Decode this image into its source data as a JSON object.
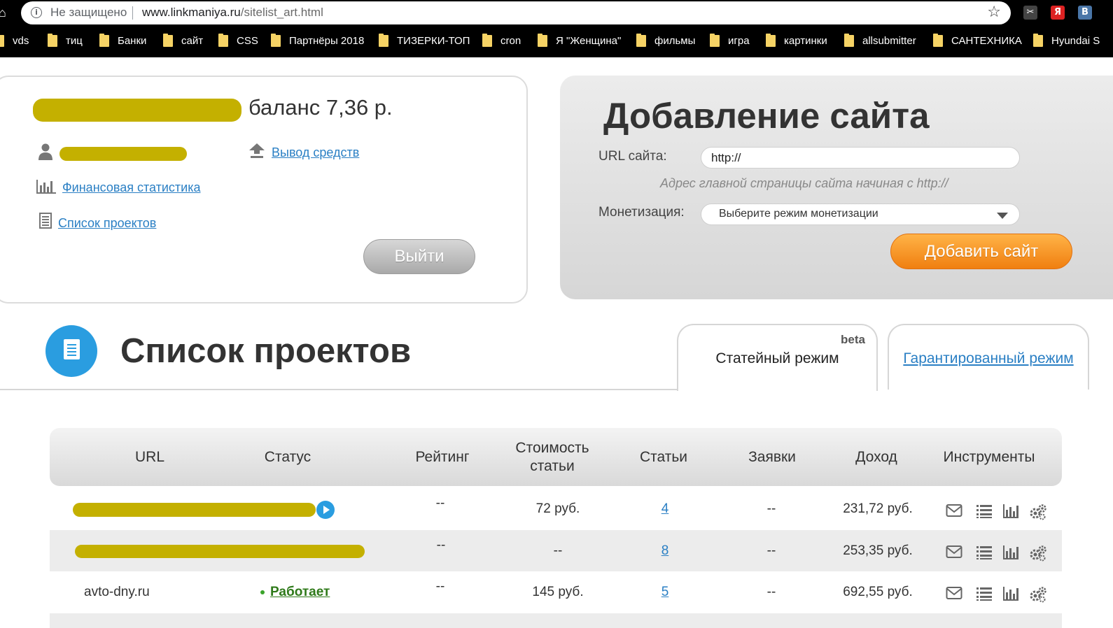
{
  "browser": {
    "security_label": "Не защищено",
    "url_domain": "www.linkmaniya.ru",
    "url_path": "/sitelist_art.html",
    "extensions": [
      {
        "name": "scissors-extension-icon",
        "glyph": "✂",
        "bg": "#444"
      },
      {
        "name": "yandex-extension-icon",
        "glyph": "Я",
        "bg": "#d22"
      },
      {
        "name": "vk-extension-icon",
        "glyph": "B",
        "bg": "#4a76a8"
      }
    ],
    "bookmarks": [
      "vds",
      "тиц",
      "Банки",
      "сайт",
      "CSS",
      "Партнёры 2018",
      "ТИЗЕРКИ-ТОП",
      "cron",
      "Я \"Женщина\"",
      "фильмы",
      "игра",
      "картинки",
      "allsubmitter",
      "САНТЕХНИКА",
      "Hyundai S"
    ]
  },
  "account": {
    "balance_text": "баланс 7,36 р.",
    "withdraw_link": "Вывод средств",
    "stats_link": "Финансовая статистика",
    "projects_link": "Список проектов",
    "logout_label": "Выйти"
  },
  "add_site": {
    "title": "Добавление сайта",
    "url_label": "URL сайта:",
    "url_value": "http://",
    "url_hint": "Адрес главной страницы сайта начиная с http://",
    "monet_label": "Монетизация:",
    "monet_selected": "Выберите режим монетизации",
    "submit_label": "Добавить сайт",
    "accent_color": "#f07f10"
  },
  "projects": {
    "title": "Список проектов",
    "tabs": [
      {
        "label": "Статейный режим",
        "badge": "beta",
        "active": true
      },
      {
        "label": "Гарантированный режим",
        "active": false
      }
    ],
    "columns": [
      "URL",
      "Статус",
      "Рейтинг",
      "Стоимость статьи",
      "Статьи",
      "Заявки",
      "Доход",
      "Инструменты"
    ],
    "rows": [
      {
        "url": "",
        "status": "",
        "rating": "--",
        "price": "72 руб.",
        "articles": "4",
        "requests": "--",
        "income": "231,72 руб."
      },
      {
        "url": "",
        "status": "",
        "rating": "--",
        "price": "--",
        "articles": "8",
        "requests": "--",
        "income": "253,35 руб."
      },
      {
        "url": "avto-dny.ru",
        "status": "Работает",
        "rating": "--",
        "price": "145 руб.",
        "articles": "5",
        "requests": "--",
        "income": "692,55 руб."
      }
    ],
    "tool_icons": [
      "mail-icon",
      "list-icon",
      "bar-chart-icon",
      "gears-icon"
    ]
  }
}
